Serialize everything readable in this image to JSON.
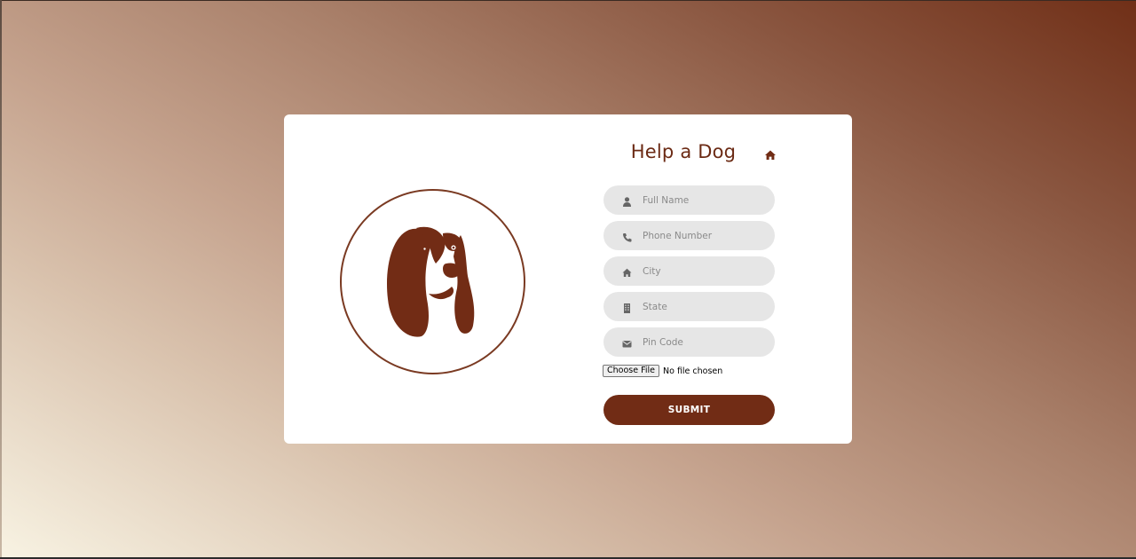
{
  "colors": {
    "brand": "#712c15",
    "field_bg": "#e6e6e6",
    "card_bg": "#ffffff"
  },
  "form": {
    "title": "Help a Dog",
    "home_icon": "home-icon",
    "fields": [
      {
        "icon": "user-icon",
        "placeholder": "Full Name",
        "value": ""
      },
      {
        "icon": "phone-icon",
        "placeholder": "Phone Number",
        "value": ""
      },
      {
        "icon": "home-icon",
        "placeholder": "City",
        "value": ""
      },
      {
        "icon": "building-icon",
        "placeholder": "State",
        "value": ""
      },
      {
        "icon": "envelope-icon",
        "placeholder": "Pin Code",
        "value": ""
      }
    ],
    "file": {
      "button_label": "Choose File",
      "status": "No file chosen"
    },
    "submit_label": "SUBMIT"
  },
  "logo": {
    "icon": "dog-logo-icon"
  }
}
